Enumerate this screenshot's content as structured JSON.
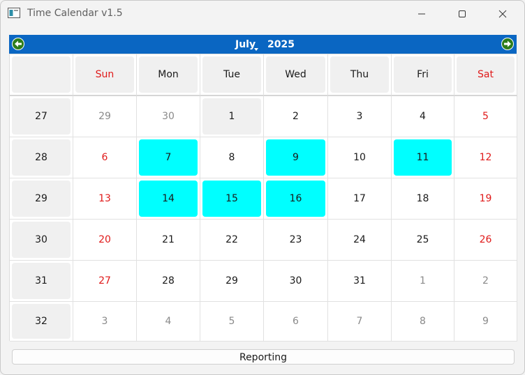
{
  "window": {
    "title": "Time Calendar v1.5"
  },
  "navbar": {
    "month": "July",
    "year": "2025",
    "prev_icon": "prev-arrow-icon",
    "next_icon": "next-arrow-icon"
  },
  "calendar": {
    "day_headers": [
      "Sun",
      "Mon",
      "Tue",
      "Wed",
      "Thu",
      "Fri",
      "Sat"
    ],
    "weeks": [
      {
        "week": "27",
        "days": [
          "29",
          "30",
          "1",
          "2",
          "3",
          "4",
          "5"
        ]
      },
      {
        "week": "28",
        "days": [
          "6",
          "7",
          "8",
          "9",
          "10",
          "11",
          "12"
        ]
      },
      {
        "week": "29",
        "days": [
          "13",
          "14",
          "15",
          "16",
          "17",
          "18",
          "19"
        ]
      },
      {
        "week": "30",
        "days": [
          "20",
          "21",
          "22",
          "23",
          "24",
          "25",
          "26"
        ]
      },
      {
        "week": "31",
        "days": [
          "27",
          "28",
          "29",
          "30",
          "31",
          "1",
          "2"
        ]
      },
      {
        "week": "32",
        "days": [
          "3",
          "4",
          "5",
          "6",
          "7",
          "8",
          "9"
        ]
      }
    ],
    "highlighted_dates": [
      "7",
      "9",
      "11",
      "14",
      "15",
      "16"
    ],
    "today": "1"
  },
  "footer": {
    "reporting_label": "Reporting"
  },
  "colors": {
    "nav_bg": "#0a66c2",
    "highlight": "#00ffff",
    "weekend": "#e01a1a",
    "other_month": "#8a8a8a"
  }
}
